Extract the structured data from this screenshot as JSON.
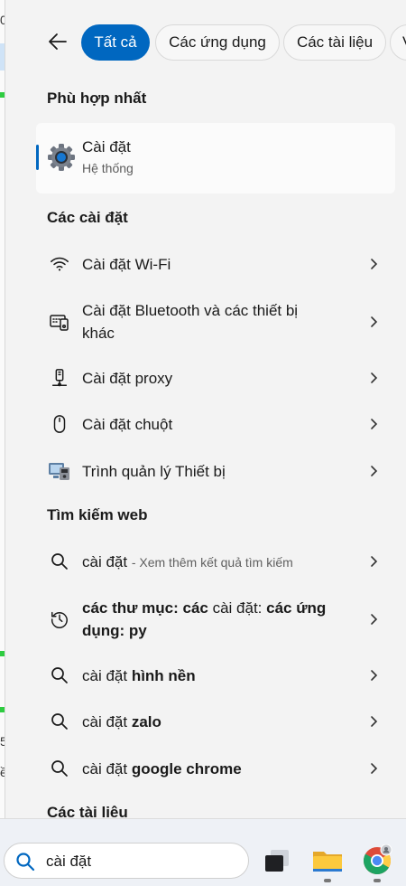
{
  "tabs": {
    "all": "Tất cả",
    "apps": "Các ứng dụng",
    "docs": "Các tài liệu",
    "more": "V"
  },
  "best_match": {
    "title": "Phù hợp nhất",
    "name": "Cài đặt",
    "subtitle": "Hệ thống",
    "icon": "gear-icon"
  },
  "settings": {
    "title": "Các cài đặt",
    "items": [
      {
        "label": "Cài đặt Wi-Fi",
        "icon": "wifi-icon"
      },
      {
        "label_line1": "Cài đặt Bluetooth và các thiết bị",
        "label_line2": "khác",
        "icon": "bluetooth-devices-icon"
      },
      {
        "label": "Cài đặt proxy",
        "icon": "proxy-icon"
      },
      {
        "label": "Cài đặt chuột",
        "icon": "mouse-icon"
      },
      {
        "label": "Trình quản lý Thiết bị",
        "icon": "device-manager-icon"
      }
    ]
  },
  "web": {
    "title": "Tìm kiếm web",
    "items": [
      {
        "query": "cài đặt",
        "suffix": "- Xem thêm kết quả tìm kiếm",
        "icon": "search-icon"
      },
      {
        "p1": "các thư mục: các",
        "p2": " cài đặt: ",
        "p3": "các ứng",
        "line2": "dụng: py",
        "icon": "history-icon"
      },
      {
        "query": "cài đặt ",
        "bold": "hình nền",
        "icon": "search-icon"
      },
      {
        "query": "cài đặt ",
        "bold": "zalo",
        "icon": "search-icon"
      },
      {
        "query": "cài đặt ",
        "bold": "google chrome",
        "icon": "search-icon"
      }
    ]
  },
  "documents_title": "Các tài liệu",
  "taskbar": {
    "search_value": "cài đặt",
    "apps": [
      "task-view-icon",
      "file-explorer-icon",
      "chrome-icon"
    ]
  },
  "colors": {
    "accent": "#0067c0",
    "panel": "#f3f3f3"
  },
  "left_strip_chars": [
    "0",
    "5",
    "ề"
  ]
}
